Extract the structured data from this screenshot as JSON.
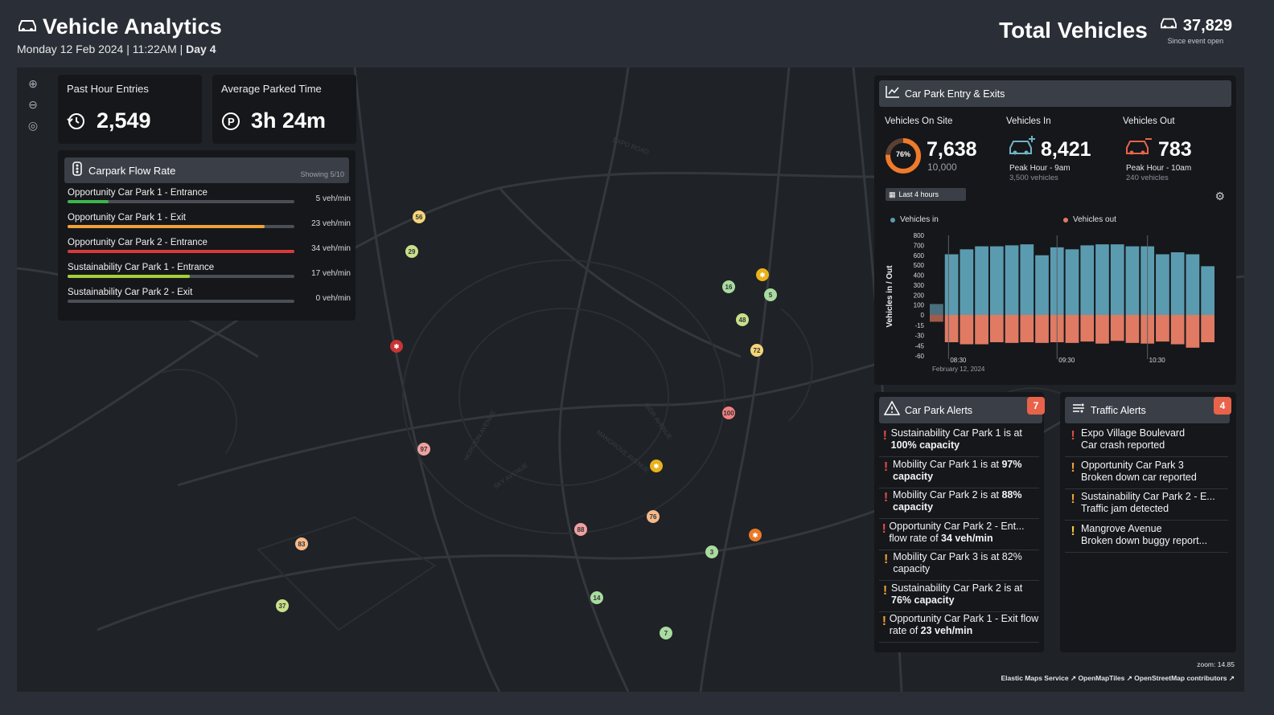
{
  "header": {
    "title": "Vehicle Analytics",
    "date": "Monday 12 Feb 2024 | 11:22AM |",
    "day": "Day 4",
    "total_label": "Total Vehicles",
    "total_value": "37,829",
    "total_sub": "Since event open"
  },
  "kpis": {
    "entries_label": "Past Hour Entries",
    "entries_value": "2,549",
    "parked_label": "Average Parked Time",
    "parked_value": "3h 24m"
  },
  "flow": {
    "title": "Carpark Flow Rate",
    "showing": "Showing 5/10",
    "rows": [
      {
        "name": "Opportunity Car Park 1 - Entrance",
        "rate": "5 veh/min",
        "pct": 0.18,
        "color": "#3bb54a"
      },
      {
        "name": "Opportunity Car Park 1 - Exit",
        "rate": "23 veh/min",
        "pct": 0.87,
        "color": "#f0a03a"
      },
      {
        "name": "Opportunity Car Park 2 - Entrance",
        "rate": "34 veh/min",
        "pct": 1.0,
        "color": "#d63a3a"
      },
      {
        "name": "Sustainability Car Park 1 - Entrance",
        "rate": "17 veh/min",
        "pct": 0.54,
        "color": "#a4cf3a"
      },
      {
        "name": "Sustainability Car Park 2 - Exit",
        "rate": "0 veh/min",
        "pct": 0.0,
        "color": "#a4cf3a"
      }
    ]
  },
  "carpark": {
    "title": "Car Park Entry & Exits",
    "on_site_label": "Vehicles On Site",
    "on_site_pct": "76%",
    "on_site_fraction": 0.76,
    "on_site_value": "7,638",
    "on_site_capacity": "10,000",
    "in_label": "Vehicles In",
    "in_value": "8,421",
    "in_peak": "Peak Hour - 9am",
    "in_peak_sub": "3,500 vehicles",
    "out_label": "Vehicles Out",
    "out_value": "783",
    "out_peak": "Peak Hour - 10am",
    "out_peak_sub": "240 vehicles",
    "range": "Last 4 hours"
  },
  "chart_data": {
    "type": "bar",
    "ylabel": "Vehicles in / Out",
    "series": [
      {
        "name": "Vehicles in",
        "color": "#5b9bb0",
        "values": [
          110,
          610,
          660,
          690,
          690,
          700,
          710,
          600,
          680,
          660,
          700,
          710,
          710,
          690,
          690,
          610,
          630,
          610,
          490
        ]
      },
      {
        "name": "Vehicles out",
        "color": "#e07a63",
        "values": [
          -10,
          -40,
          -43,
          -43,
          -40,
          -41,
          -40,
          -41,
          -40,
          -41,
          -39,
          -42,
          -38,
          -41,
          -42,
          -39,
          -43,
          -48,
          -40
        ]
      }
    ],
    "yticks_pos": [
      800,
      700,
      600,
      500,
      400,
      300,
      200,
      100,
      0
    ],
    "yticks_neg": [
      -15,
      -30,
      -45,
      -60
    ],
    "xticks": [
      "08:30",
      "09:30",
      "10:30"
    ],
    "date_label": "February 12, 2024"
  },
  "car_park_alerts": {
    "title": "Car Park Alerts",
    "count": "7",
    "items": [
      {
        "text": "Sustainability Car Park 1 is at ",
        "bold": "100% capacity",
        "color": "#e24a4a"
      },
      {
        "text": "Mobility Car Park 1 is at ",
        "bold": "97% capacity",
        "color": "#e24a4a"
      },
      {
        "text": "Mobility Car Park 2 is at ",
        "bold": "88% capacity",
        "color": "#e24a4a"
      },
      {
        "text": "Opportunity Car Park 2 - Ent... flow rate of ",
        "bold": "34 veh/min",
        "color": "#e24a4a"
      },
      {
        "text": "Mobility Car Park 3 is at 82% capacity",
        "bold": "",
        "color": "#f0a03a"
      },
      {
        "text": "Sustainability Car Park 2 is at ",
        "bold": "76% capacity",
        "color": "#f0a03a"
      },
      {
        "text": "Opportunity Car Park 1 - Exit flow rate of ",
        "bold": "23 veh/min",
        "color": "#f0a03a"
      }
    ]
  },
  "traffic_alerts": {
    "title": "Traffic Alerts",
    "count": "4",
    "items": [
      {
        "line1": "Expo Village Boulevard",
        "line2": "Car crash reported",
        "color": "#e24a4a"
      },
      {
        "line1": "Opportunity Car Park 3",
        "line2": "Broken down car reported",
        "color": "#f0a03a"
      },
      {
        "line1": "Sustainability Car Park 2 - E...",
        "line2": "Traffic jam detected",
        "color": "#f0a03a"
      },
      {
        "line1": "Mangrove Avenue",
        "line2": "Broken down buggy report...",
        "color": "#f0d03a"
      }
    ]
  },
  "map": {
    "zoom": "zoom: 14.85",
    "attribution": [
      "Elastic Maps Service",
      "OpenMapTiles",
      "OpenStreetMap contributors"
    ],
    "street_labels": [
      "EXPO ROAD",
      "SIDR AVENUE",
      "HORIZON AVENUE",
      "SKY AVENUE",
      "MANGROVE AVENUE"
    ],
    "markers": [
      {
        "label": "56",
        "color": "#f4d57a"
      },
      {
        "label": "29",
        "color": "#c9e08a"
      },
      {
        "label": "16",
        "color": "#a8dba0"
      },
      {
        "label": "5",
        "color": "#a8dba0"
      },
      {
        "label": "48",
        "color": "#c9e08a"
      },
      {
        "label": "72",
        "color": "#f4d57a"
      },
      {
        "label": "100",
        "color": "#f08080"
      },
      {
        "label": "97",
        "color": "#f0a0a0"
      },
      {
        "label": "76",
        "color": "#f5b98a"
      },
      {
        "label": "88",
        "color": "#f0a0a0"
      },
      {
        "label": "83",
        "color": "#f5b98a"
      },
      {
        "label": "3",
        "color": "#a8dba0"
      },
      {
        "label": "14",
        "color": "#a8dba0"
      },
      {
        "label": "7",
        "color": "#a8dba0"
      },
      {
        "label": "37",
        "color": "#c9e08a"
      }
    ]
  }
}
